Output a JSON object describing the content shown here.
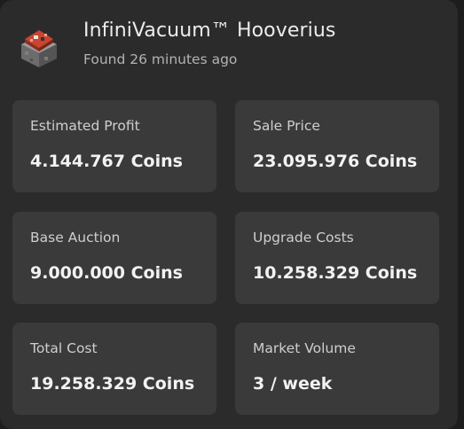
{
  "header": {
    "icon": "infinivacuum-item-icon",
    "title": "InfiniVacuum™ Hooverius",
    "subtitle": "Found 26 minutes ago"
  },
  "stats": [
    {
      "label": "Estimated Profit",
      "value": "4.144.767 Coins"
    },
    {
      "label": "Sale Price",
      "value": "23.095.976 Coins"
    },
    {
      "label": "Base Auction",
      "value": "9.000.000 Coins"
    },
    {
      "label": "Upgrade Costs",
      "value": "10.258.329 Coins"
    },
    {
      "label": "Total Cost",
      "value": "19.258.329 Coins"
    },
    {
      "label": "Market Volume",
      "value": "3 / week"
    }
  ],
  "colors": {
    "background": "#2b2b2b",
    "tile": "#3a3a3a",
    "text_primary": "#ececec",
    "text_secondary": "#b3b3b3"
  }
}
